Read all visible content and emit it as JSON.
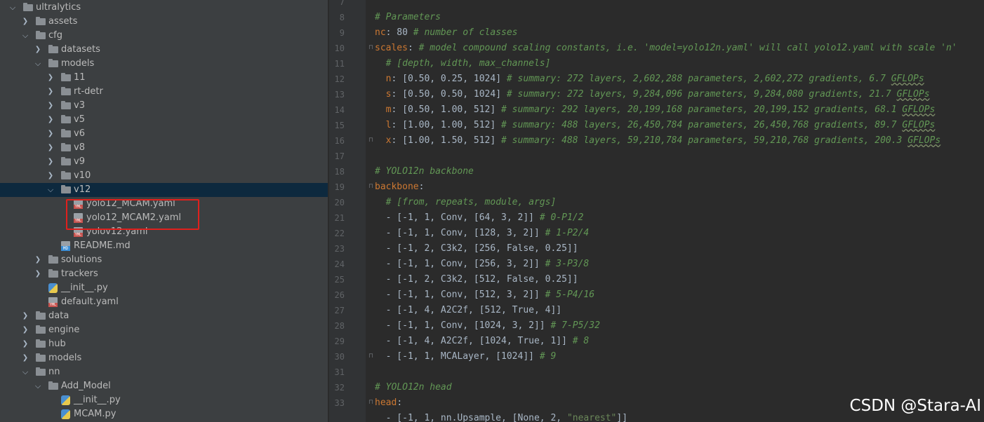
{
  "project_tree": [
    {
      "label": "ultralytics",
      "depth": 0,
      "arrow": "open",
      "icon": "folder-icon",
      "name": "tree-item-ultralytics"
    },
    {
      "label": "assets",
      "depth": 1,
      "arrow": "closed",
      "icon": "folder-icon",
      "name": "tree-item-assets"
    },
    {
      "label": "cfg",
      "depth": 1,
      "arrow": "open",
      "icon": "folder-icon",
      "name": "tree-item-cfg"
    },
    {
      "label": "datasets",
      "depth": 2,
      "arrow": "closed",
      "icon": "folder-icon",
      "name": "tree-item-datasets"
    },
    {
      "label": "models",
      "depth": 2,
      "arrow": "open",
      "icon": "folder-icon",
      "name": "tree-item-cfg-models"
    },
    {
      "label": "11",
      "depth": 3,
      "arrow": "closed",
      "icon": "folder-icon",
      "name": "tree-item-11"
    },
    {
      "label": "rt-detr",
      "depth": 3,
      "arrow": "closed",
      "icon": "folder-icon",
      "name": "tree-item-rt-detr"
    },
    {
      "label": "v3",
      "depth": 3,
      "arrow": "closed",
      "icon": "folder-icon",
      "name": "tree-item-v3"
    },
    {
      "label": "v5",
      "depth": 3,
      "arrow": "closed",
      "icon": "folder-icon",
      "name": "tree-item-v5"
    },
    {
      "label": "v6",
      "depth": 3,
      "arrow": "closed",
      "icon": "folder-icon",
      "name": "tree-item-v6"
    },
    {
      "label": "v8",
      "depth": 3,
      "arrow": "closed",
      "icon": "folder-icon",
      "name": "tree-item-v8"
    },
    {
      "label": "v9",
      "depth": 3,
      "arrow": "closed",
      "icon": "folder-icon",
      "name": "tree-item-v9"
    },
    {
      "label": "v10",
      "depth": 3,
      "arrow": "closed",
      "icon": "folder-icon",
      "name": "tree-item-v10"
    },
    {
      "label": "v12",
      "depth": 3,
      "arrow": "open",
      "icon": "folder-icon",
      "name": "tree-item-v12",
      "selected": true
    },
    {
      "label": "yolo12_MCAM.yaml",
      "depth": 4,
      "arrow": "none",
      "icon": "yaml-file-icon",
      "name": "tree-item-yolo12-mcam-yaml"
    },
    {
      "label": "yolo12_MCAM2.yaml",
      "depth": 4,
      "arrow": "none",
      "icon": "yaml-file-icon",
      "name": "tree-item-yolo12-mcam2-yaml"
    },
    {
      "label": "yolov12.yaml",
      "depth": 4,
      "arrow": "none",
      "icon": "yaml-file-icon",
      "name": "tree-item-yolov12-yaml"
    },
    {
      "label": "README.md",
      "depth": 3,
      "arrow": "none",
      "icon": "markdown-file-icon",
      "name": "tree-item-readme"
    },
    {
      "label": "solutions",
      "depth": 2,
      "arrow": "closed",
      "icon": "folder-icon",
      "name": "tree-item-solutions"
    },
    {
      "label": "trackers",
      "depth": 2,
      "arrow": "closed",
      "icon": "folder-icon",
      "name": "tree-item-trackers"
    },
    {
      "label": "__init__.py",
      "depth": 2,
      "arrow": "none",
      "icon": "python-file-icon",
      "name": "tree-item-cfg-init-py"
    },
    {
      "label": "default.yaml",
      "depth": 2,
      "arrow": "none",
      "icon": "yaml-file-icon",
      "name": "tree-item-default-yaml"
    },
    {
      "label": "data",
      "depth": 1,
      "arrow": "closed",
      "icon": "folder-icon",
      "name": "tree-item-data"
    },
    {
      "label": "engine",
      "depth": 1,
      "arrow": "closed",
      "icon": "folder-icon",
      "name": "tree-item-engine"
    },
    {
      "label": "hub",
      "depth": 1,
      "arrow": "closed",
      "icon": "folder-icon",
      "name": "tree-item-hub"
    },
    {
      "label": "models",
      "depth": 1,
      "arrow": "closed",
      "icon": "folder-icon",
      "name": "tree-item-models"
    },
    {
      "label": "nn",
      "depth": 1,
      "arrow": "open",
      "icon": "folder-icon",
      "name": "tree-item-nn"
    },
    {
      "label": "Add_Model",
      "depth": 2,
      "arrow": "open",
      "icon": "folder-icon",
      "name": "tree-item-add-model"
    },
    {
      "label": "__init__.py",
      "depth": 3,
      "arrow": "none",
      "icon": "python-file-icon",
      "name": "tree-item-add-model-init-py"
    },
    {
      "label": "MCAM.py",
      "depth": 3,
      "arrow": "none",
      "icon": "python-file-icon",
      "name": "tree-item-mcam-py"
    }
  ],
  "editor": {
    "lines": [
      {
        "n": "7",
        "fold": false,
        "t": []
      },
      {
        "n": "8",
        "fold": false,
        "t": [
          {
            "c": "cm",
            "s": "# Parameters"
          }
        ]
      },
      {
        "n": "9",
        "fold": false,
        "t": [
          {
            "c": "key",
            "s": "nc"
          },
          {
            "c": "",
            "s": ": 80 "
          },
          {
            "c": "cm",
            "s": "# number of classes"
          }
        ]
      },
      {
        "n": "10",
        "fold": true,
        "t": [
          {
            "c": "key",
            "s": "scales"
          },
          {
            "c": "",
            "s": ": "
          },
          {
            "c": "cm",
            "s": "# model compound scaling constants, i.e. 'model=yolo12n.yaml' will call yolo12.yaml with scale 'n'"
          }
        ]
      },
      {
        "n": "11",
        "fold": false,
        "t": [
          {
            "c": "",
            "s": "  "
          },
          {
            "c": "cm",
            "s": "# [depth, width, max_channels]"
          }
        ]
      },
      {
        "n": "12",
        "fold": false,
        "t": [
          {
            "c": "",
            "s": "  "
          },
          {
            "c": "key",
            "s": "n"
          },
          {
            "c": "",
            "s": ": [0.50, 0.25, 1024] "
          },
          {
            "c": "cm",
            "s": "# summary: 272 layers, 2,602,288 parameters, 2,602,272 gradients, 6.7 "
          },
          {
            "c": "cmw",
            "s": "GFLOPs"
          }
        ]
      },
      {
        "n": "13",
        "fold": false,
        "t": [
          {
            "c": "",
            "s": "  "
          },
          {
            "c": "key",
            "s": "s"
          },
          {
            "c": "",
            "s": ": [0.50, 0.50, 1024] "
          },
          {
            "c": "cm",
            "s": "# summary: 272 layers, 9,284,096 parameters, 9,284,080 gradients, 21.7 "
          },
          {
            "c": "cmw",
            "s": "GFLOPs"
          }
        ]
      },
      {
        "n": "14",
        "fold": false,
        "t": [
          {
            "c": "",
            "s": "  "
          },
          {
            "c": "key",
            "s": "m"
          },
          {
            "c": "",
            "s": ": [0.50, 1.00, 512] "
          },
          {
            "c": "cm",
            "s": "# summary: 292 layers, 20,199,168 parameters, 20,199,152 gradients, 68.1 "
          },
          {
            "c": "cmw",
            "s": "GFLOPs"
          }
        ]
      },
      {
        "n": "15",
        "fold": false,
        "t": [
          {
            "c": "",
            "s": "  "
          },
          {
            "c": "key",
            "s": "l"
          },
          {
            "c": "",
            "s": ": [1.00, 1.00, 512] "
          },
          {
            "c": "cm",
            "s": "# summary: 488 layers, 26,450,784 parameters, 26,450,768 gradients, 89.7 "
          },
          {
            "c": "cmw",
            "s": "GFLOPs"
          }
        ]
      },
      {
        "n": "16",
        "fold": true,
        "t": [
          {
            "c": "",
            "s": "  "
          },
          {
            "c": "key",
            "s": "x"
          },
          {
            "c": "",
            "s": ": [1.00, 1.50, 512] "
          },
          {
            "c": "cm",
            "s": "# summary: 488 layers, 59,210,784 parameters, 59,210,768 gradients, 200.3 "
          },
          {
            "c": "cmw",
            "s": "GFLOPs"
          }
        ]
      },
      {
        "n": "17",
        "fold": false,
        "t": []
      },
      {
        "n": "18",
        "fold": false,
        "t": [
          {
            "c": "cm",
            "s": "# YOLO12n backbone"
          }
        ]
      },
      {
        "n": "19",
        "fold": true,
        "t": [
          {
            "c": "key",
            "s": "backbone"
          },
          {
            "c": "",
            "s": ":"
          }
        ]
      },
      {
        "n": "20",
        "fold": false,
        "t": [
          {
            "c": "",
            "s": "  "
          },
          {
            "c": "cm",
            "s": "# [from, repeats, module, args]"
          }
        ]
      },
      {
        "n": "21",
        "fold": false,
        "t": [
          {
            "c": "",
            "s": "  - [-1, 1, Conv, [64, 3, 2]] "
          },
          {
            "c": "cm",
            "s": "# 0-P1/2"
          }
        ]
      },
      {
        "n": "22",
        "fold": false,
        "t": [
          {
            "c": "",
            "s": "  - [-1, 1, Conv, [128, 3, 2]] "
          },
          {
            "c": "cm",
            "s": "# 1-P2/4"
          }
        ]
      },
      {
        "n": "23",
        "fold": false,
        "t": [
          {
            "c": "",
            "s": "  - [-1, 2, C3k2, [256, False, 0.25]]"
          }
        ]
      },
      {
        "n": "24",
        "fold": false,
        "t": [
          {
            "c": "",
            "s": "  - [-1, 1, Conv, [256, 3, 2]] "
          },
          {
            "c": "cm",
            "s": "# 3-P3/8"
          }
        ]
      },
      {
        "n": "25",
        "fold": false,
        "t": [
          {
            "c": "",
            "s": "  - [-1, 2, C3k2, [512, False, 0.25]]"
          }
        ]
      },
      {
        "n": "26",
        "fold": false,
        "t": [
          {
            "c": "",
            "s": "  - [-1, 1, Conv, [512, 3, 2]] "
          },
          {
            "c": "cm",
            "s": "# 5-P4/16"
          }
        ]
      },
      {
        "n": "27",
        "fold": false,
        "t": [
          {
            "c": "",
            "s": "  - [-1, 4, A2C2f, [512, True, 4]]"
          }
        ]
      },
      {
        "n": "28",
        "fold": false,
        "t": [
          {
            "c": "",
            "s": "  - [-1, 1, Conv, [1024, 3, 2]] "
          },
          {
            "c": "cm",
            "s": "# 7-P5/32"
          }
        ]
      },
      {
        "n": "29",
        "fold": false,
        "t": [
          {
            "c": "",
            "s": "  - [-1, 4, A2C2f, [1024, True, 1]] "
          },
          {
            "c": "cm",
            "s": "# 8"
          }
        ]
      },
      {
        "n": "30",
        "fold": true,
        "t": [
          {
            "c": "",
            "s": "  - [-1, 1, MCALayer, [1024]] "
          },
          {
            "c": "cm",
            "s": "# 9"
          }
        ]
      },
      {
        "n": "31",
        "fold": false,
        "t": []
      },
      {
        "n": "32",
        "fold": false,
        "t": [
          {
            "c": "cm",
            "s": "# YOLO12n head"
          }
        ]
      },
      {
        "n": "33",
        "fold": true,
        "t": [
          {
            "c": "key",
            "s": "head"
          },
          {
            "c": "",
            "s": ":"
          }
        ]
      },
      {
        "n": "",
        "fold": false,
        "t": [
          {
            "c": "",
            "s": "  - [-1, 1, nn.Upsample, [None, 2, "
          },
          {
            "c": "str",
            "s": "\"nearest\""
          },
          {
            "c": "",
            "s": "]]"
          }
        ]
      }
    ]
  },
  "watermark": "CSDN @Stara-AI",
  "colors": {
    "tree_bg": "#3c3f41",
    "editor_bg": "#2b2b2b",
    "selected_row": "#0d293e",
    "highlight_box": "#e0201d",
    "comment": "#629755",
    "yaml_key": "#cc7832"
  }
}
